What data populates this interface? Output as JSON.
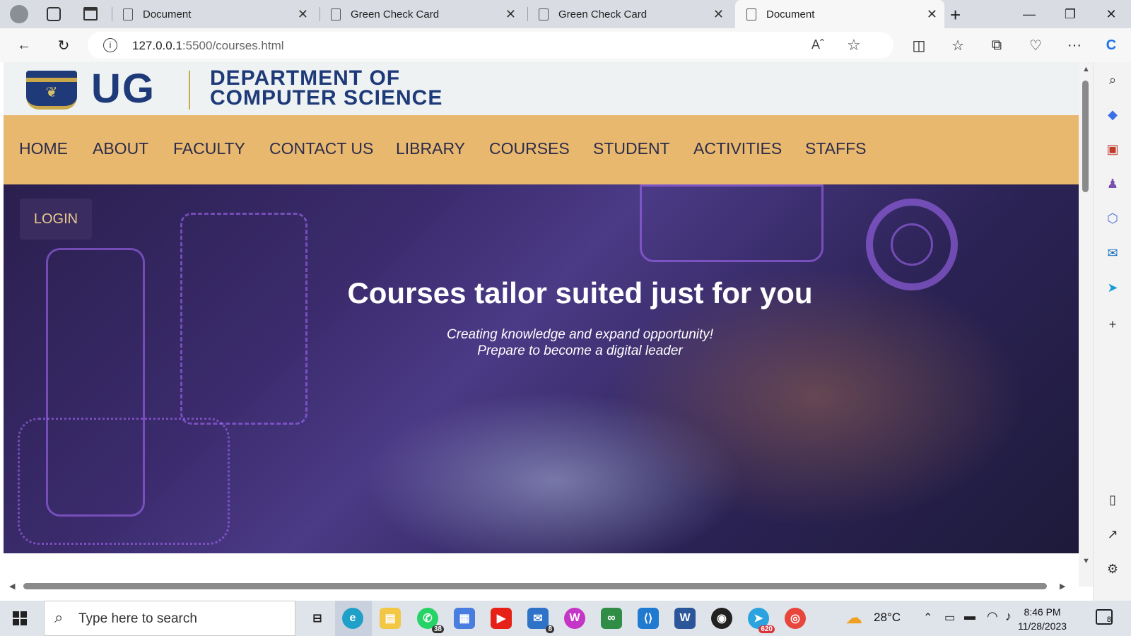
{
  "browser": {
    "tabs": [
      {
        "label": "Document",
        "active": false
      },
      {
        "label": "Green Check Card",
        "active": false
      },
      {
        "label": "Green Check Card",
        "active": false
      },
      {
        "label": "Document",
        "active": true
      }
    ],
    "url_host": "127.0.0.1",
    "url_path": ":5500/courses.html"
  },
  "site": {
    "logo_text": "UG",
    "dept_line1": "DEPARTMENT OF",
    "dept_line2": "COMPUTER SCIENCE",
    "nav": [
      "HOME",
      "ABOUT",
      "FACULTY",
      "CONTACT US",
      "LIBRARY",
      "COURSES",
      "STUDENT",
      "ACTIVITIES",
      "STAFFS"
    ],
    "login_label": "LOGIN",
    "hero_title": "Courses tailor suited just for you",
    "hero_sub1": "Creating knowledge and expand opportunity!",
    "hero_sub2": "Prepare to become a digital leader"
  },
  "taskbar": {
    "search_placeholder": "Type here to search",
    "whatsapp_badge": "38",
    "mail_badge": "8",
    "telegram_badge": "620",
    "temperature": "28°C",
    "time": "8:46 PM",
    "date": "11/28/2023",
    "notifications": "8"
  },
  "colors": {
    "nav_bg": "#e8b86f",
    "brand_blue": "#1f3a78",
    "login_bg": "#3a2c5e"
  }
}
